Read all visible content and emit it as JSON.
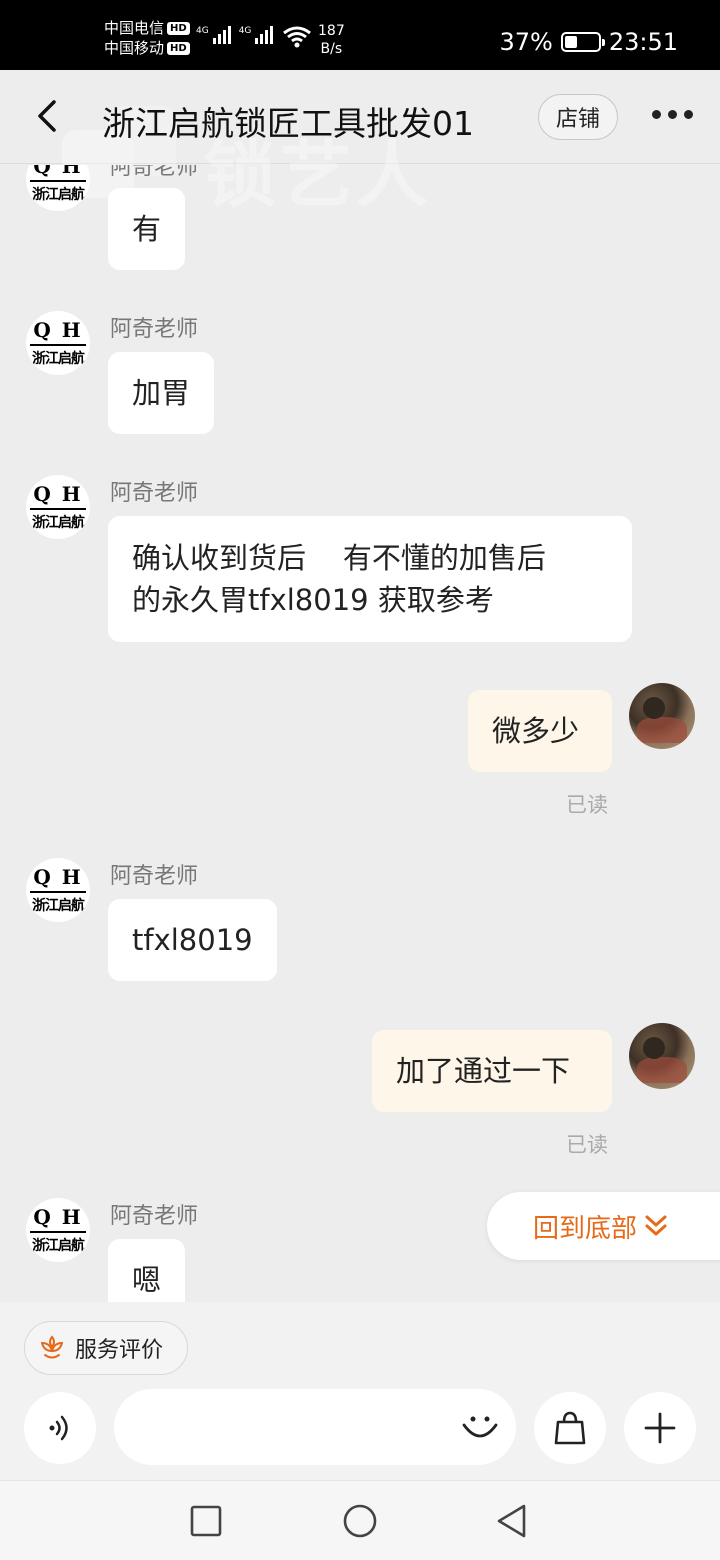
{
  "status_bar": {
    "carrier1": "中国电信",
    "carrier2": "中国移动",
    "hd": "HD",
    "net1": "4G",
    "net2": "4G",
    "speed_value": "187",
    "speed_unit": "B/s",
    "battery_percent": "37%",
    "battery_level": 0.37,
    "time": "23:51"
  },
  "header": {
    "title": "浙江启航锁匠工具批发01",
    "shop_label": "店铺",
    "watermark": "锁艺人"
  },
  "avatar_logo": {
    "qh": "Q H",
    "name": "浙江启航"
  },
  "messages": [
    {
      "sender": "阿奇老师",
      "text": "有"
    },
    {
      "sender": "阿奇老师",
      "text": "加胃"
    },
    {
      "sender": "阿奇老师",
      "line1": "确认收到货后    有不懂的加售后",
      "line2": "的永久胃tfxl8019 获取参考"
    },
    {
      "text": "微多少",
      "status": "已读"
    },
    {
      "sender": "阿奇老师",
      "text": "tfxl8019"
    },
    {
      "text": "加了通过一下",
      "status": "已读"
    },
    {
      "sender": "阿奇老师",
      "text": "嗯"
    }
  ],
  "scroll_to_bottom": "回到底部",
  "service_rating": "服务评价",
  "input": {
    "placeholder": ""
  },
  "colors": {
    "accent": "#e56a1a",
    "bubble_self": "#fdf6e9",
    "bubble_other": "#ffffff",
    "background": "#ededed"
  }
}
